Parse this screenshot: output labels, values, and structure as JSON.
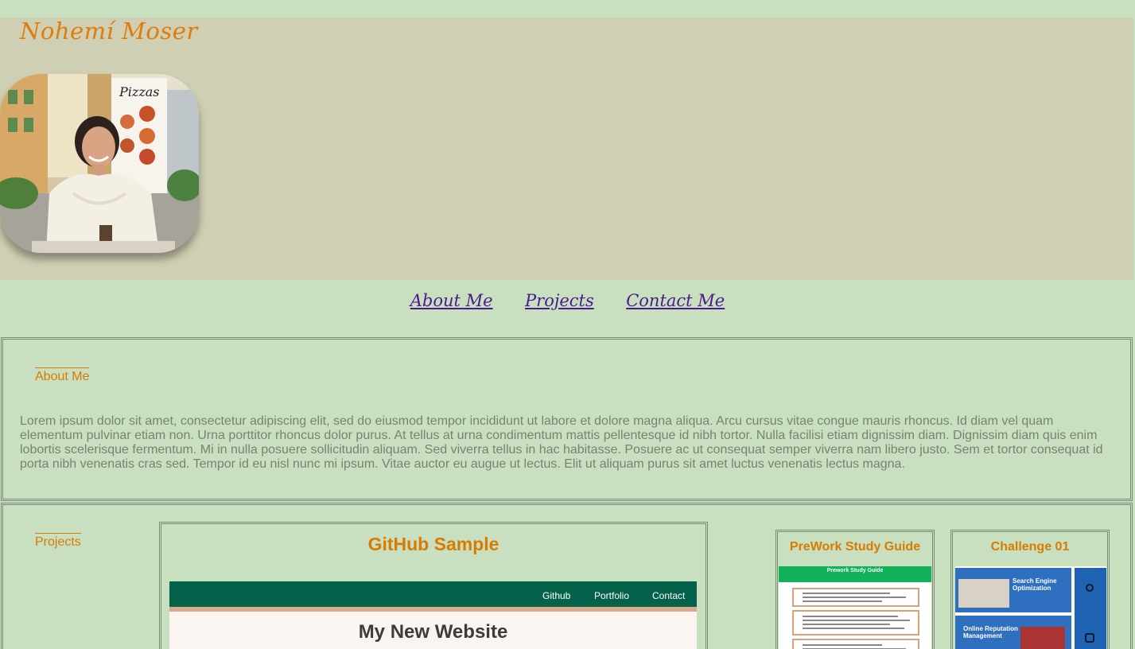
{
  "header": {
    "site_name": "Nohemí Moser"
  },
  "nav": {
    "items": [
      "About Me",
      "Projects",
      "Contact Me"
    ]
  },
  "about": {
    "title": "About Me",
    "text": "Lorem ipsum dolor sit amet, consectetur adipiscing elit, sed do eiusmod tempor incididunt ut labore et dolore magna aliqua. Arcu cursus vitae congue mauris rhoncus. Id diam vel quam elementum pulvinar etiam non. Urna porttitor rhoncus dolor purus. At tellus at urna condimentum mattis pellentesque id nibh tortor. Nulla facilisi etiam dignissim diam. Dignissim diam quis enim lobortis scelerisque fermentum. Mi in nulla posuere sollicitudin aliquam. Sed viverra tellus in hac habitasse. Posuere ac ut consequat semper viverra nam libero justo. Sem et tortor consequat id porta nibh venenatis cras sed. Tempor id eu nisl nunc mi ipsum. Vitae auctor eu augue ut lectus. Elit ut aliquam purus sit amet luctus venenatis lectus magna."
  },
  "projects": {
    "title": "Projects",
    "github_card": {
      "title": "GitHub Sample",
      "nav": [
        "Github",
        "Portfolio",
        "Contact"
      ],
      "heading": "My New Website"
    },
    "prework_card": {
      "title": "PreWork Study Guide",
      "banner": "Prework Study Guide"
    },
    "challenge_card": {
      "title": "Challenge 01",
      "seo_heading": "Search Engine Optimization",
      "orm_heading": "Online Reputation Management"
    }
  },
  "colors": {
    "page_bg": "#c8dfc0",
    "header_bg": "#cfcfb3",
    "accent": "#d97b00",
    "nav_link": "#4b1a8c"
  }
}
